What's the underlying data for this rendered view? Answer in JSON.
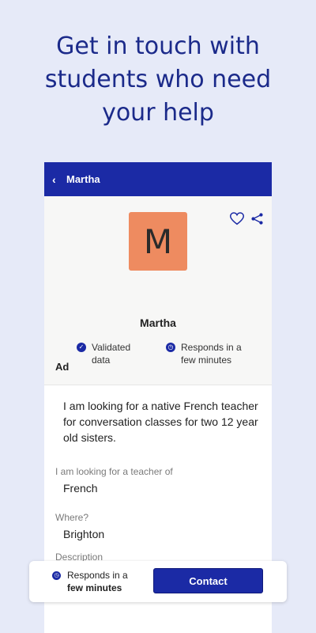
{
  "headline": {
    "line1": "Get in touch with",
    "line2": "students who need",
    "line3": "your help"
  },
  "topbar": {
    "back_icon": "chevron-left-icon",
    "title": "Martha"
  },
  "profile": {
    "avatar_letter": "M",
    "avatar_color": "#ee8b60",
    "name": "Martha",
    "badges": [
      {
        "icon": "check-circle-icon",
        "label": "Validated data"
      },
      {
        "icon": "clock-icon",
        "label": "Responds in a few minutes"
      }
    ],
    "actions": [
      {
        "icon": "heart-icon"
      },
      {
        "icon": "share-icon"
      }
    ]
  },
  "ad": {
    "section_label": "Ad",
    "text": "I am looking for a native French teacher for conversation classes for two 12 year old sisters.",
    "fields": [
      {
        "label": "I am looking for a teacher of",
        "value": "French"
      },
      {
        "label": "Where?",
        "value": "Brighton"
      },
      {
        "label": "Description",
        "value": ""
      }
    ]
  },
  "bottom_bar": {
    "response_line1": "Responds in a",
    "response_line2": "few minutes",
    "contact_label": "Contact"
  },
  "colors": {
    "background": "#e6eaf8",
    "brand": "#1b2aa5",
    "headline": "#1b2a8a"
  }
}
